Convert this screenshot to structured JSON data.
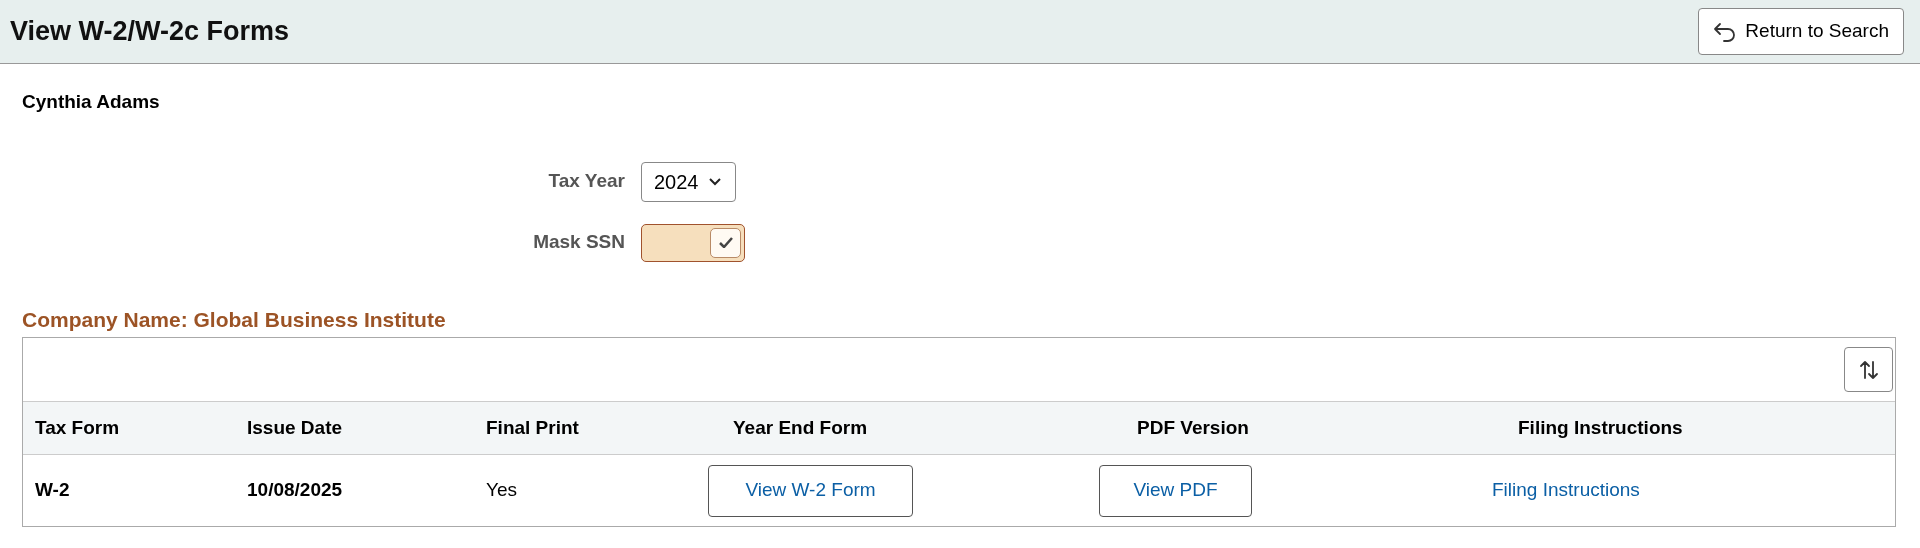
{
  "header": {
    "title": "View W-2/W-2c Forms",
    "return_button": "Return to Search"
  },
  "employee_name": "Cynthia Adams",
  "fields": [
    {
      "kind": "select",
      "label": "Tax Year",
      "value": "2024"
    },
    {
      "kind": "toggle",
      "label": "Mask SSN",
      "checked": true
    }
  ],
  "section": {
    "title": "Company Name: Global Business Institute"
  },
  "table": {
    "columns": [
      "Tax Form",
      "Issue Date",
      "Final Print",
      "Year End Form",
      "PDF Version",
      "Filing Instructions"
    ],
    "rows": [
      {
        "cells": [
          {
            "kind": "strong",
            "text": "W-2"
          },
          {
            "kind": "strong",
            "text": "10/08/2025"
          },
          {
            "kind": "plain",
            "text": "Yes"
          },
          {
            "kind": "button",
            "text": "View W-2 Form"
          },
          {
            "kind": "button",
            "text": "View PDF"
          },
          {
            "kind": "link",
            "text": "Filing Instructions"
          }
        ]
      }
    ]
  }
}
